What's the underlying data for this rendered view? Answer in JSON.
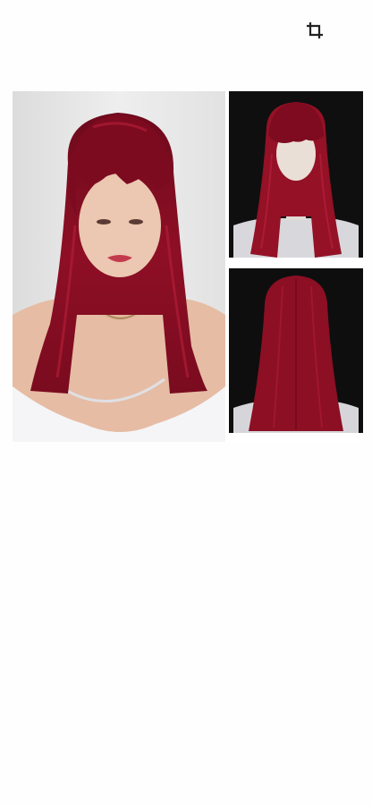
{
  "toolbar": {
    "crop_icon": "crop-icon"
  },
  "image": {
    "kind": "product-photo-collage",
    "panels": [
      "model-front",
      "mannequin-front",
      "mannequin-back"
    ],
    "colors": {
      "hair": "#8e0f25",
      "hair_dark": "#5a0614",
      "hair_highlight": "#b8203a",
      "studio_light_bg": "#e9eaea",
      "studio_dark_bg": "#101010",
      "skin": "#e8c2ac",
      "top_white": "#f4f4f6"
    }
  }
}
